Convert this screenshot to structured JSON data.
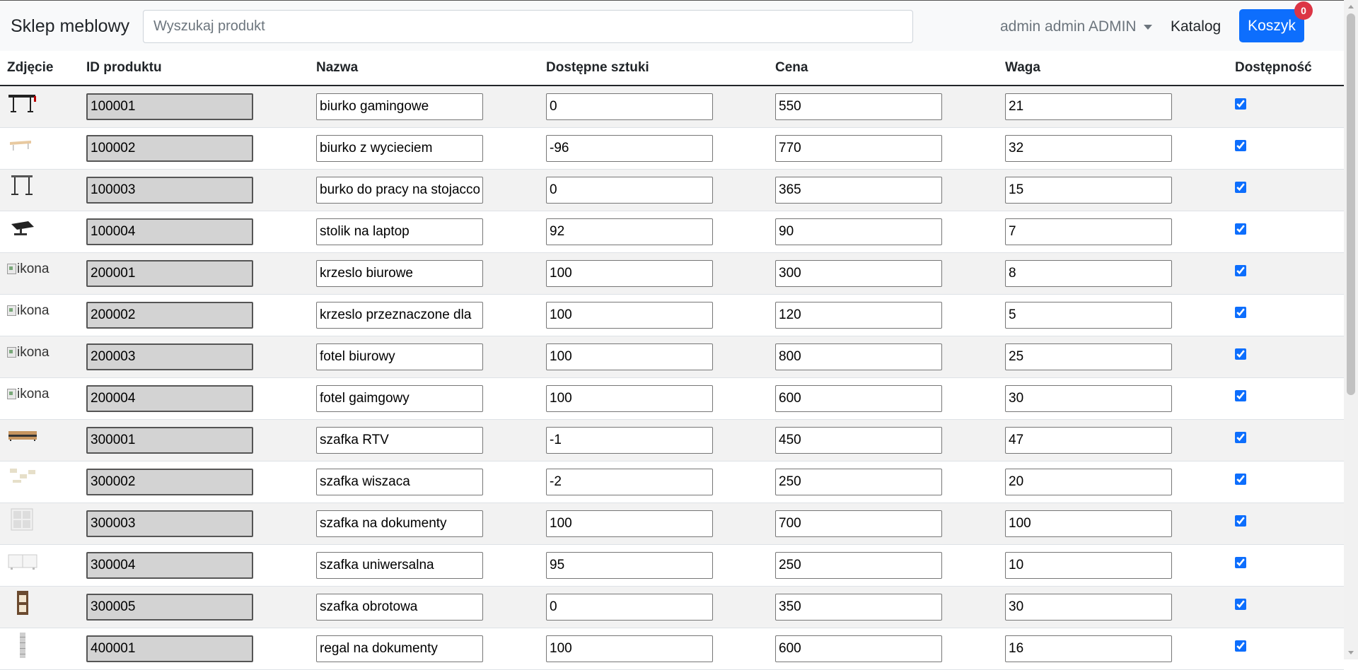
{
  "navbar": {
    "brand": "Sklep meblowy",
    "search_placeholder": "Wyszukaj produkt",
    "user_menu": "admin admin ADMIN",
    "katalog": "Katalog",
    "cart_label": "Koszyk",
    "cart_count": "0"
  },
  "table": {
    "headers": [
      "Zdjęcie",
      "ID produktu",
      "Nazwa",
      "Dostępne sztuki",
      "Cena",
      "Waga",
      "Dostępność"
    ],
    "image_alt": "ikona",
    "rows": [
      {
        "image": "desk-gaming",
        "id": "100001",
        "name": "biurko gamingowe",
        "qty": "0",
        "price": "550",
        "weight": "21",
        "available": true
      },
      {
        "image": "desk-corner",
        "id": "100002",
        "name": "biurko z wycieciem",
        "qty": "-96",
        "price": "770",
        "weight": "32",
        "available": true
      },
      {
        "image": "desk-standing",
        "id": "100003",
        "name": "burko do pracy na stojacco",
        "qty": "0",
        "price": "365",
        "weight": "15",
        "available": true
      },
      {
        "image": "laptop-table",
        "id": "100004",
        "name": "stolik na laptop",
        "qty": "92",
        "price": "90",
        "weight": "7",
        "available": true
      },
      {
        "image": "broken",
        "id": "200001",
        "name": "krzeslo biurowe",
        "qty": "100",
        "price": "300",
        "weight": "8",
        "available": true
      },
      {
        "image": "broken",
        "id": "200002",
        "name": "krzeslo przeznaczone dla",
        "qty": "100",
        "price": "120",
        "weight": "5",
        "available": true
      },
      {
        "image": "broken",
        "id": "200003",
        "name": "fotel biurowy",
        "qty": "100",
        "price": "800",
        "weight": "25",
        "available": true
      },
      {
        "image": "broken",
        "id": "200004",
        "name": "fotel gaimgowy",
        "qty": "100",
        "price": "600",
        "weight": "30",
        "available": true
      },
      {
        "image": "tv-cabinet",
        "id": "300001",
        "name": "szafka RTV",
        "qty": "-1",
        "price": "450",
        "weight": "47",
        "available": true
      },
      {
        "image": "wall-shelves",
        "id": "300002",
        "name": "szafka wiszaca",
        "qty": "-2",
        "price": "250",
        "weight": "20",
        "available": true
      },
      {
        "image": "document-cabinet",
        "id": "300003",
        "name": "szafka na dokumenty",
        "qty": "100",
        "price": "700",
        "weight": "100",
        "available": true
      },
      {
        "image": "white-cabinet",
        "id": "300004",
        "name": "szafka uniwersalna",
        "qty": "95",
        "price": "250",
        "weight": "10",
        "available": true
      },
      {
        "image": "rotating-cabinet",
        "id": "300005",
        "name": "szafka obrotowa",
        "qty": "0",
        "price": "350",
        "weight": "30",
        "available": true
      },
      {
        "image": "bookshelf",
        "id": "400001",
        "name": "regal na dokumenty",
        "qty": "100",
        "price": "600",
        "weight": "16",
        "available": true
      }
    ]
  }
}
